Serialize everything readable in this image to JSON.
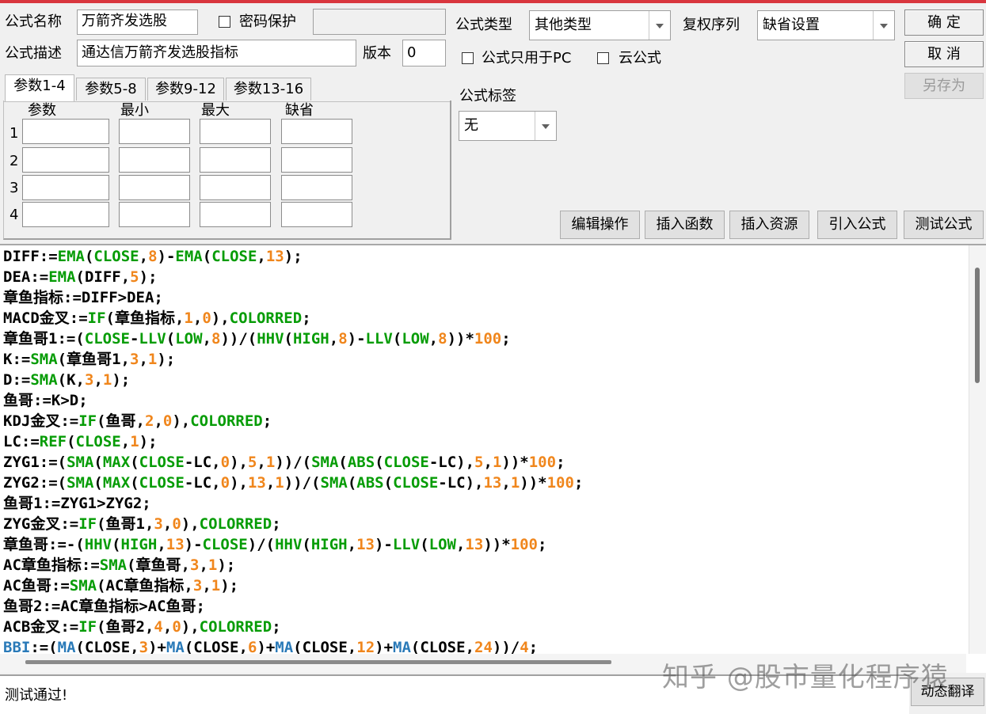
{
  "labels": {
    "name": "公式名称",
    "password": "密码保护",
    "type": "公式类型",
    "fq": "复权序列",
    "desc": "公式描述",
    "version": "版本",
    "pc_only": "公式只用于PC",
    "cloud": "云公式",
    "tag": "公式标签"
  },
  "fields": {
    "name": "万箭齐发选股",
    "password": "",
    "desc": "通达信万箭齐发选股指标",
    "version": "0",
    "type": "其他类型",
    "fq": "缺省设置",
    "tag": "无"
  },
  "buttons": {
    "ok": "确 定",
    "cancel": "取 消",
    "saveas": "另存为",
    "edit": "编辑操作",
    "insert_fn": "插入函数",
    "insert_res": "插入资源",
    "import": "引入公式",
    "test": "测试公式",
    "translate": "动态翻译"
  },
  "tabs": [
    "参数1-4",
    "参数5-8",
    "参数9-12",
    "参数13-16"
  ],
  "param_headers": [
    "参数",
    "最小",
    "最大",
    "缺省"
  ],
  "param_rows": [
    "1",
    "2",
    "3",
    "4"
  ],
  "status": "测试通过!",
  "watermark": "知乎 @股市量化程序猿",
  "colors": {
    "function": "#069c06",
    "number": "#f0861c",
    "bbi": "#2a7ab8",
    "accent": "#d9363e"
  },
  "code": [
    [
      [
        "k",
        "DIFF:="
      ],
      [
        "f",
        "EMA"
      ],
      [
        "k",
        "("
      ],
      [
        "f",
        "CLOSE"
      ],
      [
        "k",
        ","
      ],
      [
        "n",
        "8"
      ],
      [
        "k",
        ")-"
      ],
      [
        "f",
        "EMA"
      ],
      [
        "k",
        "("
      ],
      [
        "f",
        "CLOSE"
      ],
      [
        "k",
        ","
      ],
      [
        "n",
        "13"
      ],
      [
        "k",
        ");"
      ]
    ],
    [
      [
        "k",
        "DEA:="
      ],
      [
        "f",
        "EMA"
      ],
      [
        "k",
        "(DIFF,"
      ],
      [
        "n",
        "5"
      ],
      [
        "k",
        ");"
      ]
    ],
    [
      [
        "k",
        "章鱼指标:=DIFF>DEA;"
      ]
    ],
    [
      [
        "k",
        "MACD金叉:="
      ],
      [
        "f",
        "IF"
      ],
      [
        "k",
        "(章鱼指标,"
      ],
      [
        "n",
        "1"
      ],
      [
        "k",
        ","
      ],
      [
        "n",
        "0"
      ],
      [
        "k",
        "),"
      ],
      [
        "f",
        "COLORRED"
      ],
      [
        "k",
        ";"
      ]
    ],
    [
      [
        "k",
        "章鱼哥1:=("
      ],
      [
        "f",
        "CLOSE"
      ],
      [
        "k",
        "-"
      ],
      [
        "f",
        "LLV"
      ],
      [
        "k",
        "("
      ],
      [
        "f",
        "LOW"
      ],
      [
        "k",
        ","
      ],
      [
        "n",
        "8"
      ],
      [
        "k",
        "))/("
      ],
      [
        "f",
        "HHV"
      ],
      [
        "k",
        "("
      ],
      [
        "f",
        "HIGH"
      ],
      [
        "k",
        ","
      ],
      [
        "n",
        "8"
      ],
      [
        "k",
        ")-"
      ],
      [
        "f",
        "LLV"
      ],
      [
        "k",
        "("
      ],
      [
        "f",
        "LOW"
      ],
      [
        "k",
        ","
      ],
      [
        "n",
        "8"
      ],
      [
        "k",
        "))*"
      ],
      [
        "n",
        "100"
      ],
      [
        "k",
        ";"
      ]
    ],
    [
      [
        "k",
        "K:="
      ],
      [
        "f",
        "SMA"
      ],
      [
        "k",
        "(章鱼哥1,"
      ],
      [
        "n",
        "3"
      ],
      [
        "k",
        ","
      ],
      [
        "n",
        "1"
      ],
      [
        "k",
        ");"
      ]
    ],
    [
      [
        "k",
        "D:="
      ],
      [
        "f",
        "SMA"
      ],
      [
        "k",
        "(K,"
      ],
      [
        "n",
        "3"
      ],
      [
        "k",
        ","
      ],
      [
        "n",
        "1"
      ],
      [
        "k",
        ");"
      ]
    ],
    [
      [
        "k",
        "鱼哥:=K>D;"
      ]
    ],
    [
      [
        "k",
        "KDJ金叉:="
      ],
      [
        "f",
        "IF"
      ],
      [
        "k",
        "(鱼哥,"
      ],
      [
        "n",
        "2"
      ],
      [
        "k",
        ","
      ],
      [
        "n",
        "0"
      ],
      [
        "k",
        "),"
      ],
      [
        "f",
        "COLORRED"
      ],
      [
        "k",
        ";"
      ]
    ],
    [
      [
        "k",
        "LC:="
      ],
      [
        "f",
        "REF"
      ],
      [
        "k",
        "("
      ],
      [
        "f",
        "CLOSE"
      ],
      [
        "k",
        ","
      ],
      [
        "n",
        "1"
      ],
      [
        "k",
        ");"
      ]
    ],
    [
      [
        "k",
        "ZYG1:=("
      ],
      [
        "f",
        "SMA"
      ],
      [
        "k",
        "("
      ],
      [
        "f",
        "MAX"
      ],
      [
        "k",
        "("
      ],
      [
        "f",
        "CLOSE"
      ],
      [
        "k",
        "-LC,"
      ],
      [
        "n",
        "0"
      ],
      [
        "k",
        "),"
      ],
      [
        "n",
        "5"
      ],
      [
        "k",
        ","
      ],
      [
        "n",
        "1"
      ],
      [
        "k",
        "))/("
      ],
      [
        "f",
        "SMA"
      ],
      [
        "k",
        "("
      ],
      [
        "f",
        "ABS"
      ],
      [
        "k",
        "("
      ],
      [
        "f",
        "CLOSE"
      ],
      [
        "k",
        "-LC),"
      ],
      [
        "n",
        "5"
      ],
      [
        "k",
        ","
      ],
      [
        "n",
        "1"
      ],
      [
        "k",
        "))*"
      ],
      [
        "n",
        "100"
      ],
      [
        "k",
        ";"
      ]
    ],
    [
      [
        "k",
        "ZYG2:=("
      ],
      [
        "f",
        "SMA"
      ],
      [
        "k",
        "("
      ],
      [
        "f",
        "MAX"
      ],
      [
        "k",
        "("
      ],
      [
        "f",
        "CLOSE"
      ],
      [
        "k",
        "-LC,"
      ],
      [
        "n",
        "0"
      ],
      [
        "k",
        "),"
      ],
      [
        "n",
        "13"
      ],
      [
        "k",
        ","
      ],
      [
        "n",
        "1"
      ],
      [
        "k",
        "))/("
      ],
      [
        "f",
        "SMA"
      ],
      [
        "k",
        "("
      ],
      [
        "f",
        "ABS"
      ],
      [
        "k",
        "("
      ],
      [
        "f",
        "CLOSE"
      ],
      [
        "k",
        "-LC),"
      ],
      [
        "n",
        "13"
      ],
      [
        "k",
        ","
      ],
      [
        "n",
        "1"
      ],
      [
        "k",
        "))*"
      ],
      [
        "n",
        "100"
      ],
      [
        "k",
        ";"
      ]
    ],
    [
      [
        "k",
        "鱼哥1:=ZYG1>ZYG2;"
      ]
    ],
    [
      [
        "k",
        "ZYG金叉:="
      ],
      [
        "f",
        "IF"
      ],
      [
        "k",
        "(鱼哥1,"
      ],
      [
        "n",
        "3"
      ],
      [
        "k",
        ","
      ],
      [
        "n",
        "0"
      ],
      [
        "k",
        "),"
      ],
      [
        "f",
        "COLORRED"
      ],
      [
        "k",
        ";"
      ]
    ],
    [
      [
        "k",
        "章鱼哥:=-("
      ],
      [
        "f",
        "HHV"
      ],
      [
        "k",
        "("
      ],
      [
        "f",
        "HIGH"
      ],
      [
        "k",
        ","
      ],
      [
        "n",
        "13"
      ],
      [
        "k",
        ")-"
      ],
      [
        "f",
        "CLOSE"
      ],
      [
        "k",
        ")/("
      ],
      [
        "f",
        "HHV"
      ],
      [
        "k",
        "("
      ],
      [
        "f",
        "HIGH"
      ],
      [
        "k",
        ","
      ],
      [
        "n",
        "13"
      ],
      [
        "k",
        ")-"
      ],
      [
        "f",
        "LLV"
      ],
      [
        "k",
        "("
      ],
      [
        "f",
        "LOW"
      ],
      [
        "k",
        ","
      ],
      [
        "n",
        "13"
      ],
      [
        "k",
        "))*"
      ],
      [
        "n",
        "100"
      ],
      [
        "k",
        ";"
      ]
    ],
    [
      [
        "k",
        "AC章鱼指标:="
      ],
      [
        "f",
        "SMA"
      ],
      [
        "k",
        "(章鱼哥,"
      ],
      [
        "n",
        "3"
      ],
      [
        "k",
        ","
      ],
      [
        "n",
        "1"
      ],
      [
        "k",
        ");"
      ]
    ],
    [
      [
        "k",
        "AC鱼哥:="
      ],
      [
        "f",
        "SMA"
      ],
      [
        "k",
        "(AC章鱼指标,"
      ],
      [
        "n",
        "3"
      ],
      [
        "k",
        ","
      ],
      [
        "n",
        "1"
      ],
      [
        "k",
        ");"
      ]
    ],
    [
      [
        "k",
        "鱼哥2:=AC章鱼指标>AC鱼哥;"
      ]
    ],
    [
      [
        "k",
        "ACB金叉:="
      ],
      [
        "f",
        "IF"
      ],
      [
        "k",
        "(鱼哥2,"
      ],
      [
        "n",
        "4"
      ],
      [
        "k",
        ","
      ],
      [
        "n",
        "0"
      ],
      [
        "k",
        "),"
      ],
      [
        "f",
        "COLORRED"
      ],
      [
        "k",
        ";"
      ]
    ],
    [
      [
        "b",
        "BBI"
      ],
      [
        "k",
        ":=("
      ],
      [
        "b",
        "MA"
      ],
      [
        "k",
        "(CLOSE,"
      ],
      [
        "n",
        "3"
      ],
      [
        "k",
        ")+"
      ],
      [
        "b",
        "MA"
      ],
      [
        "k",
        "(CLOSE,"
      ],
      [
        "n",
        "6"
      ],
      [
        "k",
        ")+"
      ],
      [
        "b",
        "MA"
      ],
      [
        "k",
        "(CLOSE,"
      ],
      [
        "n",
        "12"
      ],
      [
        "k",
        ")+"
      ],
      [
        "b",
        "MA"
      ],
      [
        "k",
        "(CLOSE,"
      ],
      [
        "n",
        "24"
      ],
      [
        "k",
        "))/"
      ],
      [
        "n",
        "4"
      ],
      [
        "k",
        ";"
      ]
    ]
  ]
}
